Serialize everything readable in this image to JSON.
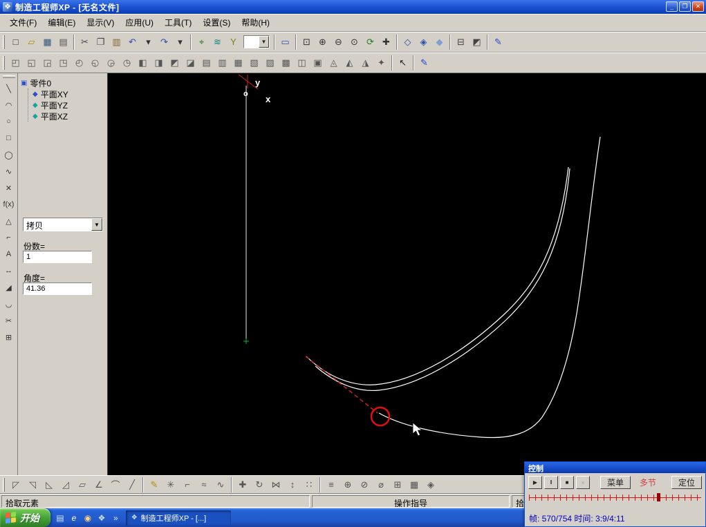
{
  "window": {
    "title": "制造工程师XP - [无名文件]",
    "overlay_timer": "3:9/4:11",
    "app_icon": "❖",
    "minimize": "_",
    "restore": "❐",
    "close": "✕"
  },
  "menu": {
    "items": [
      {
        "n": "menu-file",
        "g": "文件(F)"
      },
      {
        "n": "menu-edit",
        "g": "编辑(E)"
      },
      {
        "n": "menu-view",
        "g": "显示(V)"
      },
      {
        "n": "menu-apply",
        "g": "应用(U)"
      },
      {
        "n": "menu-tools",
        "g": "工具(T)"
      },
      {
        "n": "menu-settings",
        "g": "设置(S)"
      },
      {
        "n": "menu-help",
        "g": "帮助(H)"
      }
    ]
  },
  "toolbar1": {
    "dropdown_value": "",
    "icons_a": [
      {
        "n": "new-file-icon",
        "g": "□",
        "c": "#333333"
      },
      {
        "n": "open-folder-icon",
        "g": "▱",
        "c": "#b8860b"
      },
      {
        "n": "save-icon",
        "g": "▦",
        "c": "#33557f"
      },
      {
        "n": "print-icon",
        "g": "▤",
        "c": "#555555"
      },
      {
        "sep": true
      },
      {
        "n": "cut-icon",
        "g": "✂",
        "c": "#444455"
      },
      {
        "n": "copy-icon",
        "g": "❐",
        "c": "#444455"
      },
      {
        "n": "paste-icon",
        "g": "▥",
        "c": "#86652c"
      },
      {
        "n": "undo-icon",
        "g": "↶",
        "c": "#2a4fae"
      },
      {
        "n": "undo-dropdown-icon",
        "g": "▾",
        "c": "#333333"
      },
      {
        "n": "redo-icon",
        "g": "↷",
        "c": "#2a4fae"
      },
      {
        "n": "redo-dropdown-icon",
        "g": "▾",
        "c": "#333333"
      },
      {
        "sep": true
      },
      {
        "n": "pick-point-icon",
        "g": "⌖",
        "c": "#1f7a1f"
      },
      {
        "n": "layers-icon",
        "g": "≋",
        "c": "#0a7f7f"
      },
      {
        "n": "filter-icon",
        "g": "Y",
        "c": "#7f7f0a"
      }
    ],
    "icons_b": [
      {
        "sep": true
      },
      {
        "n": "frame-display-icon",
        "g": "▭",
        "c": "#2a4fae"
      },
      {
        "sep": true
      },
      {
        "n": "zoom-window-icon",
        "g": "⊡",
        "c": "#333333"
      },
      {
        "n": "zoom-in-icon",
        "g": "⊕",
        "c": "#333333"
      },
      {
        "n": "zoom-out-icon",
        "g": "⊖",
        "c": "#333333"
      },
      {
        "n": "zoom-all-icon",
        "g": "⊙",
        "c": "#333333"
      },
      {
        "n": "refresh-view-icon",
        "g": "⟳",
        "c": "#1f7a1f"
      },
      {
        "n": "pan-view-icon",
        "g": "✚",
        "c": "#333333"
      },
      {
        "sep": true
      },
      {
        "n": "view-axonometric-icon",
        "g": "◇",
        "c": "#2a4fae"
      },
      {
        "n": "view-front-icon",
        "g": "◈",
        "c": "#2a4fae"
      },
      {
        "n": "view-top-icon",
        "g": "◆",
        "c": "#7f9fd4"
      },
      {
        "sep": true
      },
      {
        "n": "wireframe-display-icon",
        "g": "⊟",
        "c": "#444444"
      },
      {
        "n": "shaded-display-icon",
        "g": "◩",
        "c": "#444444"
      },
      {
        "sep": true
      },
      {
        "n": "sketch-mode-icon",
        "g": "✎",
        "c": "#2244cc"
      }
    ]
  },
  "toolbar2": {
    "icons": [
      {
        "n": "extrude-add-icon",
        "g": "◰",
        "c": "#555555"
      },
      {
        "n": "revolve-add-icon",
        "g": "◱",
        "c": "#555555"
      },
      {
        "n": "sweep-add-icon",
        "g": "◲",
        "c": "#555555"
      },
      {
        "n": "loft-add-icon",
        "g": "◳",
        "c": "#555555"
      },
      {
        "n": "extrude-cut-icon",
        "g": "◴",
        "c": "#555555"
      },
      {
        "n": "revolve-cut-icon",
        "g": "◵",
        "c": "#555555"
      },
      {
        "n": "sweep-cut-icon",
        "g": "◶",
        "c": "#555555"
      },
      {
        "n": "loft-cut-icon",
        "g": "◷",
        "c": "#555555"
      },
      {
        "n": "fillet-feature-icon",
        "g": "◧",
        "c": "#555555"
      },
      {
        "n": "chamfer-feature-icon",
        "g": "◨",
        "c": "#555555"
      },
      {
        "n": "hole-feature-icon",
        "g": "◩",
        "c": "#555555"
      },
      {
        "n": "stiffener-feature-icon",
        "g": "◪",
        "c": "#555555"
      },
      {
        "n": "shell-feature-icon",
        "g": "▤",
        "c": "#555555"
      },
      {
        "n": "draft-feature-icon",
        "g": "▥",
        "c": "#555555"
      },
      {
        "n": "linear-pattern-icon",
        "g": "▦",
        "c": "#555555"
      },
      {
        "n": "circular-pattern-icon",
        "g": "▧",
        "c": "#555555"
      },
      {
        "n": "mold-tool-icon",
        "g": "▨",
        "c": "#555555"
      },
      {
        "n": "combine-tool-icon",
        "g": "▩",
        "c": "#555555"
      },
      {
        "n": "surface-stitch-icon",
        "g": "◫",
        "c": "#555555"
      },
      {
        "n": "surface-trim-icon",
        "g": "▣",
        "c": "#555555"
      },
      {
        "n": "curve-3d-icon",
        "g": "◬",
        "c": "#555555"
      },
      {
        "n": "transform-3d-icon",
        "g": "◭",
        "c": "#555555"
      },
      {
        "n": "boolean-tool-icon",
        "g": "◮",
        "c": "#555555"
      },
      {
        "n": "render-tool-icon",
        "g": "✦",
        "c": "#555555"
      },
      {
        "sep": true
      },
      {
        "n": "select-arrow-icon",
        "g": "↖",
        "c": "#222222"
      },
      {
        "sep": true
      },
      {
        "n": "sketch-pen-icon",
        "g": "✎",
        "c": "#2244cc"
      }
    ]
  },
  "left_toolbar": {
    "icons": [
      {
        "n": "line-tool-icon",
        "g": "╲",
        "c": "#333333"
      },
      {
        "n": "arc-tool-icon",
        "g": "◠",
        "c": "#333333"
      },
      {
        "n": "circle-tool-icon",
        "g": "○",
        "c": "#333333"
      },
      {
        "n": "rectangle-tool-icon",
        "g": "□",
        "c": "#333333"
      },
      {
        "n": "ellipse-tool-icon",
        "g": "◯",
        "c": "#333333"
      },
      {
        "n": "spline-tool-icon",
        "g": "∿",
        "c": "#333333"
      },
      {
        "n": "point-tool-icon",
        "g": "✕",
        "c": "#333333"
      },
      {
        "n": "formula-curve-icon",
        "g": "f(x)",
        "c": "#333333"
      },
      {
        "n": "polygon-tool-icon",
        "g": "△",
        "c": "#333333"
      },
      {
        "n": "projection-curve-icon",
        "g": "⌐",
        "c": "#333333"
      },
      {
        "n": "text-tool-icon",
        "g": "A",
        "c": "#333333"
      },
      {
        "n": "dimension-tool-icon",
        "g": "↔",
        "c": "#333333"
      },
      {
        "n": "chamfer-curve-icon",
        "g": "◢",
        "c": "#333333"
      },
      {
        "n": "fillet-curve-icon",
        "g": "◡",
        "c": "#333333"
      },
      {
        "n": "trim-curve-icon",
        "g": "✂",
        "c": "#333333"
      },
      {
        "n": "pattern-curve-icon",
        "g": "⊞",
        "c": "#333333"
      }
    ]
  },
  "tree": {
    "root": "零件0",
    "root_icon": "▣",
    "items": [
      "平面XY",
      "平面YZ",
      "平面XZ"
    ],
    "item_icon": "◆"
  },
  "params": {
    "operation": "拷贝",
    "dropdown_arrow": "▼",
    "count_label": "份数=",
    "count_value": "1",
    "angle_label": "角度=",
    "angle_value": "41.36"
  },
  "canvas": {
    "axis": {
      "y": "y",
      "o": "o",
      "x": "x"
    }
  },
  "bottom_toolbar": {
    "icons": [
      {
        "n": "surface-trim-edit-icon",
        "g": "◸",
        "c": "#555555"
      },
      {
        "n": "surface-extend-icon",
        "g": "◹",
        "c": "#555555"
      },
      {
        "n": "surface-offset-icon",
        "g": "◺",
        "c": "#555555"
      },
      {
        "n": "surface-mirror-icon",
        "g": "◿",
        "c": "#555555"
      },
      {
        "n": "surface-stitch-edit-icon",
        "g": "▱",
        "c": "#555555"
      },
      {
        "n": "surface-split-icon",
        "g": "∠",
        "c": "#555555"
      },
      {
        "n": "curve-fillet-icon",
        "g": "⌒",
        "c": "#555555"
      },
      {
        "n": "curve-chamfer-icon",
        "g": "╱",
        "c": "#555555"
      },
      {
        "sep": true
      },
      {
        "n": "sketch-edit-icon",
        "g": "✎",
        "c": "#b8860b"
      },
      {
        "n": "spline-edit-icon",
        "g": "✳",
        "c": "#555555"
      },
      {
        "n": "curve-extend-icon",
        "g": "⌐",
        "c": "#555555"
      },
      {
        "n": "curve-break-icon",
        "g": "≈",
        "c": "#555555"
      },
      {
        "n": "curve-smooth-icon",
        "g": "∿",
        "c": "#555555"
      },
      {
        "sep": true
      },
      {
        "n": "move-tool-icon",
        "g": "✚",
        "c": "#555555"
      },
      {
        "n": "rotate-tool-icon",
        "g": "↻",
        "c": "#555555"
      },
      {
        "n": "mirror-tool-icon",
        "g": "⋈",
        "c": "#555555"
      },
      {
        "n": "scale-tool-icon",
        "g": "↕",
        "c": "#555555"
      },
      {
        "n": "array-tool-icon",
        "g": "∷",
        "c": "#555555"
      },
      {
        "sep": true
      },
      {
        "n": "equidistant-icon",
        "g": "≡",
        "c": "#555555"
      },
      {
        "n": "combine-icon",
        "g": "⊕",
        "c": "#555555"
      },
      {
        "n": "section-icon",
        "g": "⊘",
        "c": "#555555"
      },
      {
        "n": "measure-icon",
        "g": "⌀",
        "c": "#555555"
      },
      {
        "n": "grid-icon",
        "g": "⊞",
        "c": "#555555"
      },
      {
        "n": "rect-array-icon",
        "g": "▦",
        "c": "#555555"
      },
      {
        "n": "circ-array-icon",
        "g": "◈",
        "c": "#555555"
      }
    ]
  },
  "status": {
    "left": "拾取元素",
    "center": "操作指导",
    "right": "拾"
  },
  "control": {
    "title": "控制",
    "play": "▶",
    "pause": "‖",
    "stop": "■",
    "step": "»",
    "menu_label": "菜单",
    "multi_label": "多节",
    "locate_label": "定位",
    "status_text": "帧:  570/754  时间:  3:9/4:11"
  },
  "taskbar": {
    "start_label": "开始",
    "task_label": "制造工程师XP - [...]",
    "task_icon": "❖",
    "overflow": "»",
    "quick_launch": [
      {
        "n": "quick-launch-desktop-icon",
        "g": "▤",
        "c": "#cfe0ff"
      },
      {
        "n": "quick-launch-browser-icon",
        "g": "e",
        "c": "#ffffff"
      },
      {
        "n": "quick-launch-security-icon",
        "g": "◉",
        "c": "#ffd27f"
      },
      {
        "n": "quick-launch-player-icon",
        "g": "❖",
        "c": "#cfe0ff"
      }
    ]
  }
}
